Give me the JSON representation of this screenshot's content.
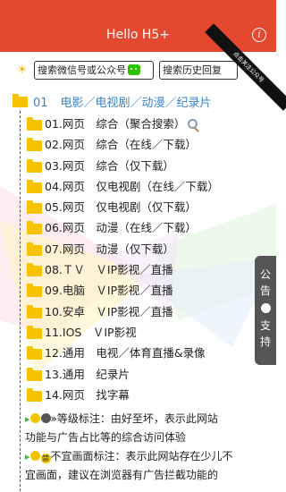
{
  "header": {
    "title": "Hello H5+",
    "info_glyph": "i"
  },
  "ribbon": {
    "text": "点击关注公众号"
  },
  "search": {
    "sun_icon": "☀",
    "btn_official": "搜索微信号或公众号",
    "btn_history": "搜索历史回复"
  },
  "category": {
    "num": "01",
    "label": "电影／电视剧／动漫／纪录片"
  },
  "items": [
    {
      "label": "01.网页　综合（聚合搜索）"
    },
    {
      "label": "02.网页　综合（在线／下载）"
    },
    {
      "label": "03.网页　综合（仅下载）"
    },
    {
      "label": "04.网页　仅电视剧（在线／下载）"
    },
    {
      "label": "05.网页　仅电视剧（仅下载）"
    },
    {
      "label": "06.网页　动漫（在线／下载）"
    },
    {
      "label": "07.网页　动漫（仅下载）"
    },
    {
      "label": "08.ＴＶ　ＶIP影视／直播"
    },
    {
      "label": "09.电脑　ＶIP影视／直播"
    },
    {
      "label": "10.安卓　ＶIP影视／直播"
    },
    {
      "label": "11.IOS　ＶIP影视"
    },
    {
      "label": "12.通用　电视／体育直播&录像"
    },
    {
      "label": "13.通用　纪录片"
    },
    {
      "label": "14.网页　找字幕"
    }
  ],
  "notes": {
    "line1": "»等级标注：由好至坏，表示此网站",
    "line2": "功能与广告占比等的综合访问体验",
    "line3": "不宜画面标注：表示此网站存在少儿不",
    "line4": "宜画面，建议在浏览器有广告拦截功能的",
    "badge_text": "禁"
  },
  "side_tab": {
    "top": "公告",
    "bottom": "支持"
  },
  "colors": {
    "header": "#e4492f",
    "folder": "#f7c200",
    "category": "#3b83c4"
  }
}
